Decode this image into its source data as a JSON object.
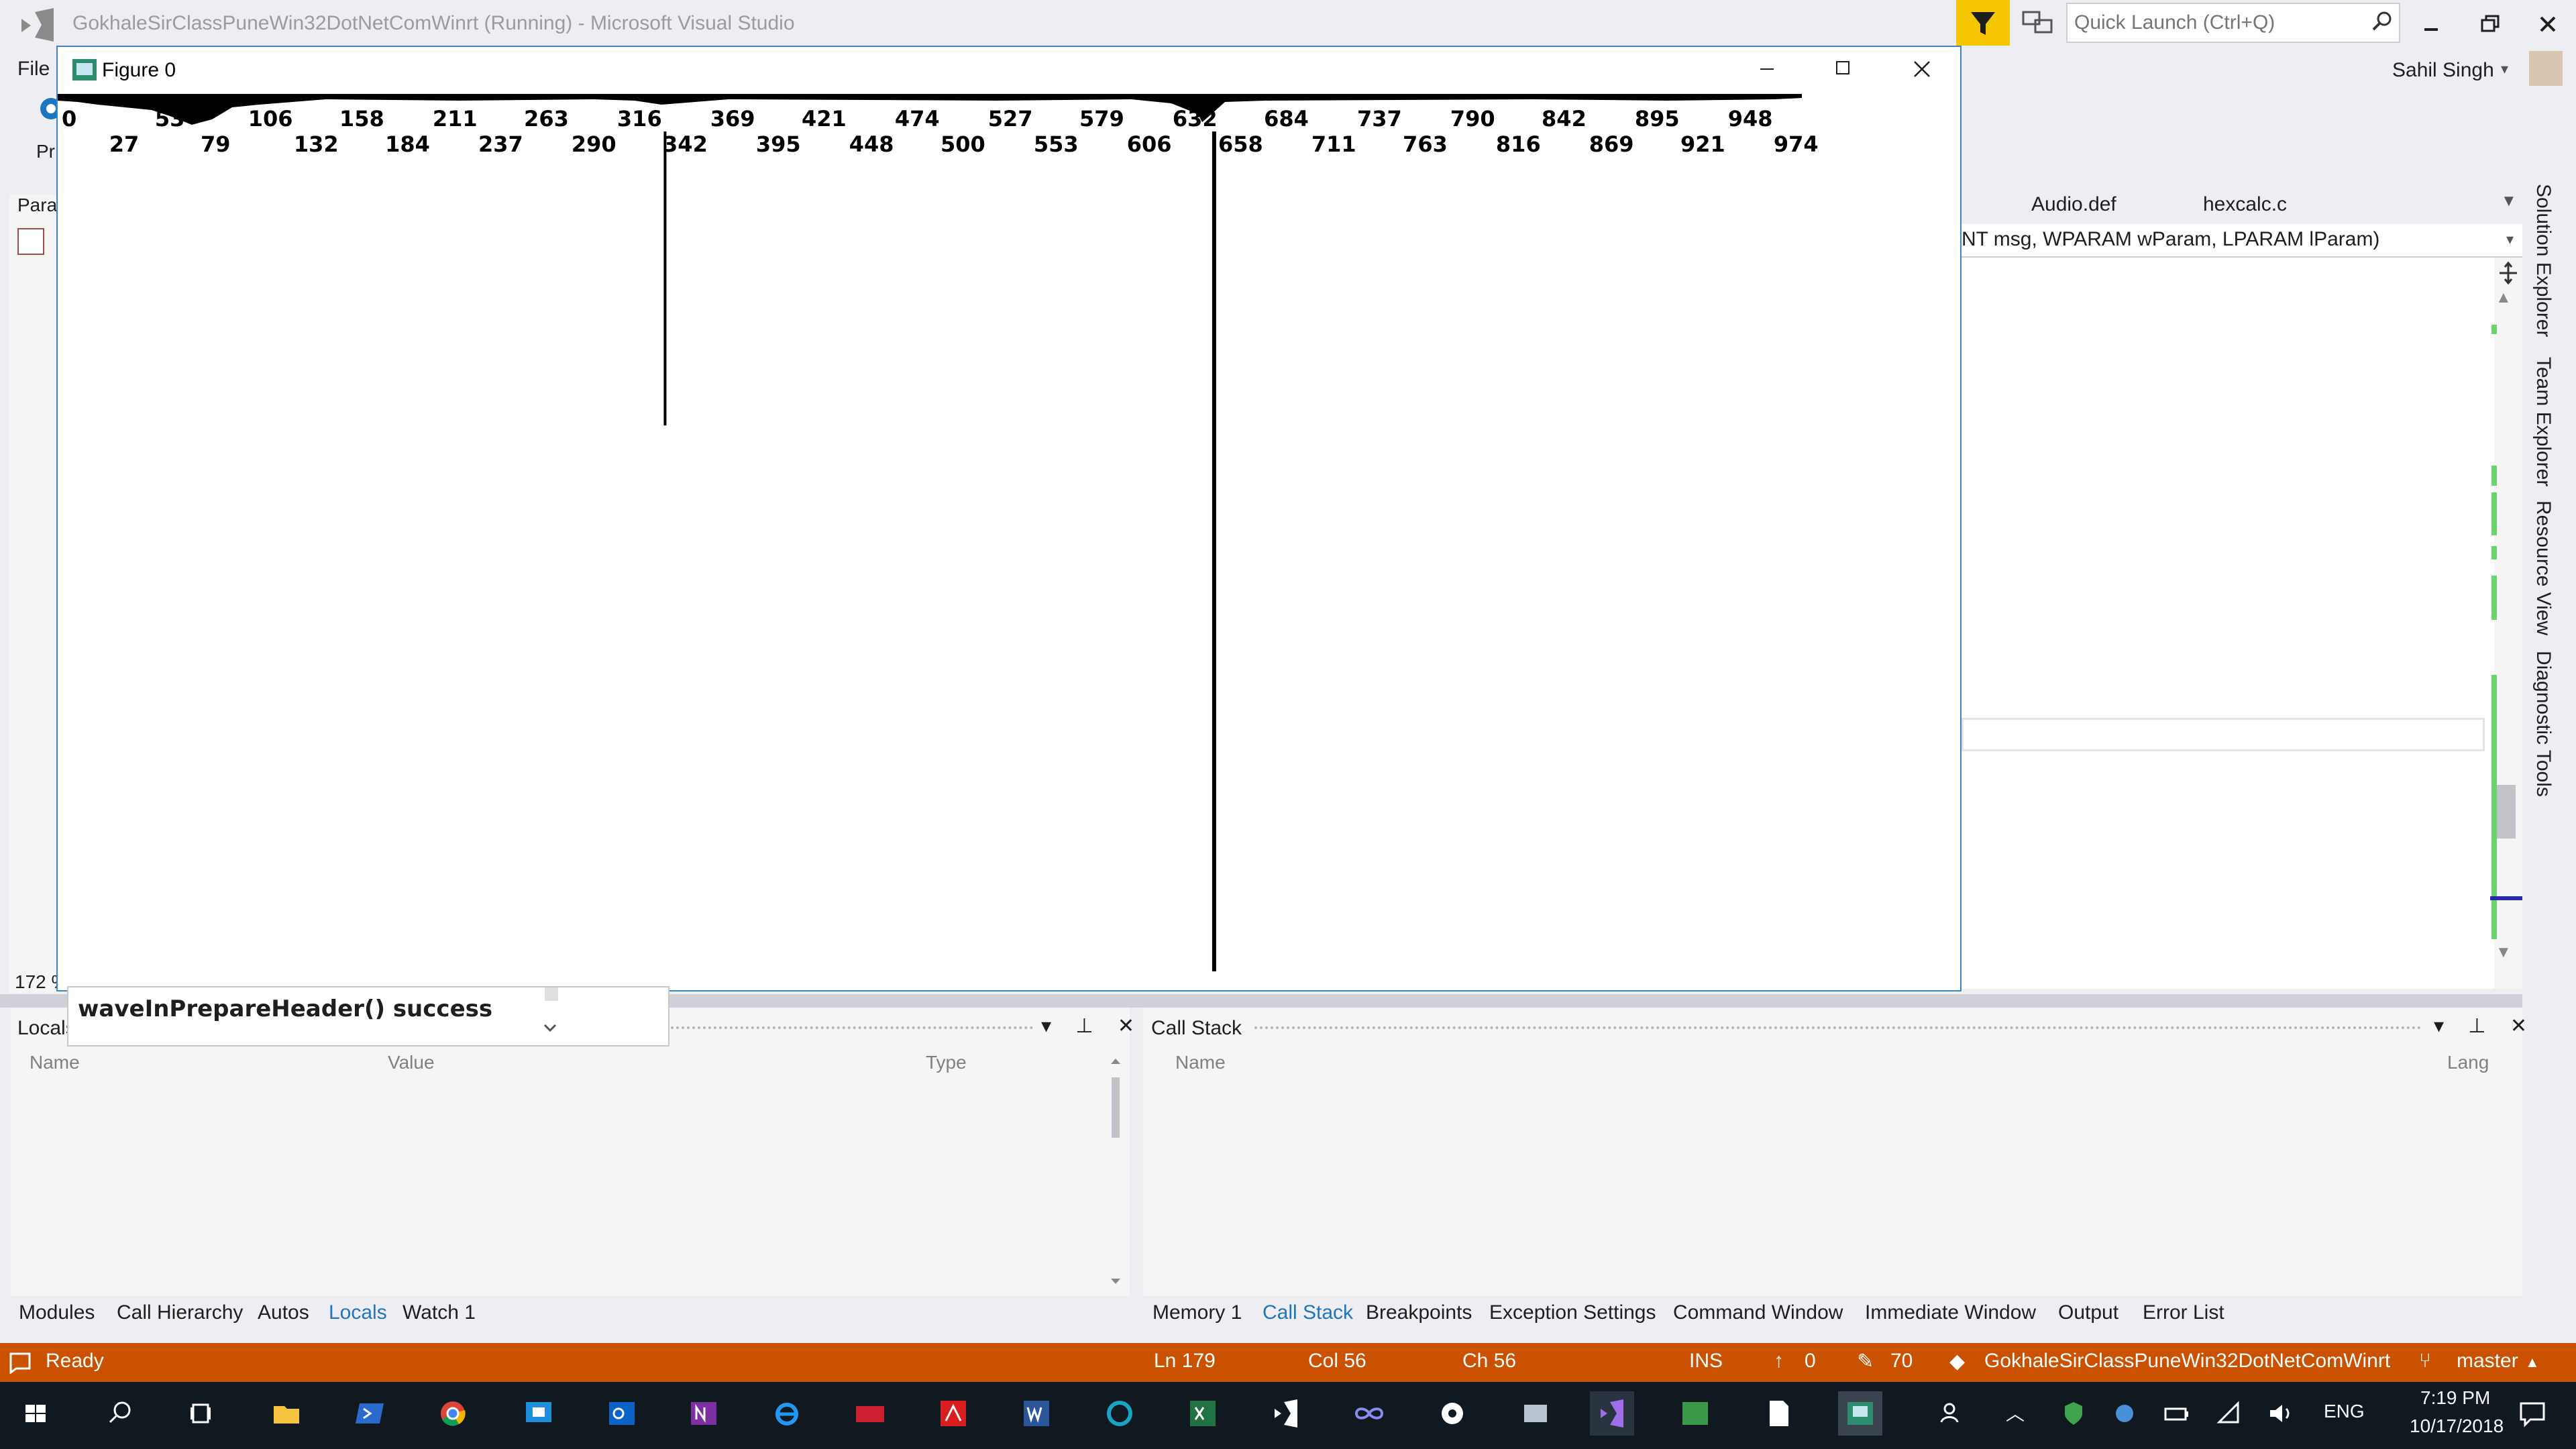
{
  "vs": {
    "title": "GokhaleSirClassPuneWin32DotNetComWinrt (Running) - Microsoft Visual Studio",
    "quick_launch_placeholder": "Quick Launch (Ctrl+Q)",
    "menu_file": "File",
    "user_name": "Sahil Singh",
    "toolbar_pr": "Pr",
    "left_para": "Para",
    "left_line_number": "172 %"
  },
  "editor": {
    "tabs": [
      "Audio.def",
      "hexcalc.c"
    ],
    "nav_text": "NT msg, WPARAM wParam, LPARAM lParam)"
  },
  "right_sidebar": [
    "Solution Explorer",
    "Team Explorer",
    "Resource View",
    "Diagnostic Tools"
  ],
  "locals": {
    "title": "Locals",
    "columns": [
      "Name",
      "Value",
      "Type"
    ]
  },
  "callstack": {
    "title": "Call Stack",
    "columns": [
      "Name",
      "Lang"
    ]
  },
  "bottom_tabs_left": [
    "Modules",
    "Call Hierarchy",
    "Autos",
    "Locals",
    "Watch 1"
  ],
  "bottom_tabs_left_active": "Locals",
  "bottom_tabs_right": [
    "Memory 1",
    "Call Stack",
    "Breakpoints",
    "Exception Settings",
    "Command Window",
    "Immediate Window",
    "Output",
    "Error List"
  ],
  "bottom_tabs_right_active": "Call Stack",
  "status": {
    "ready": "Ready",
    "ln": "Ln 179",
    "col": "Col 56",
    "ch": "Ch 56",
    "ins": "INS",
    "up_count": "0",
    "pencil_count": "70",
    "repo": "GokhaleSirClassPuneWin32DotNetComWinrt",
    "branch": "master"
  },
  "taskbar": {
    "lang": "ENG",
    "time": "7:19 PM",
    "date": "10/17/2018"
  },
  "figure": {
    "title": "Figure 0"
  },
  "popup": {
    "text": "waveInPrepareHeader() success"
  },
  "colors": {
    "status_bar": "#ca5100",
    "accent_blue": "#1c77c3",
    "filter_yellow": "#f7c602",
    "taskbar": "#101820"
  },
  "chart_data": {
    "type": "bar",
    "title": "",
    "xlabel": "",
    "ylabel": "",
    "tick_labels_row1": [
      0,
      53,
      106,
      158,
      211,
      263,
      316,
      369,
      421,
      474,
      527,
      579,
      632,
      684,
      737,
      790,
      842,
      895,
      948
    ],
    "tick_labels_row2": [
      27,
      79,
      132,
      184,
      237,
      290,
      342,
      395,
      448,
      500,
      553,
      606,
      658,
      711,
      763,
      816,
      869,
      921,
      974
    ],
    "xlim": [
      0,
      1000
    ],
    "spikes": [
      {
        "x": 312,
        "depth": 0.35
      },
      {
        "x": 624,
        "depth": 1.0
      }
    ]
  }
}
